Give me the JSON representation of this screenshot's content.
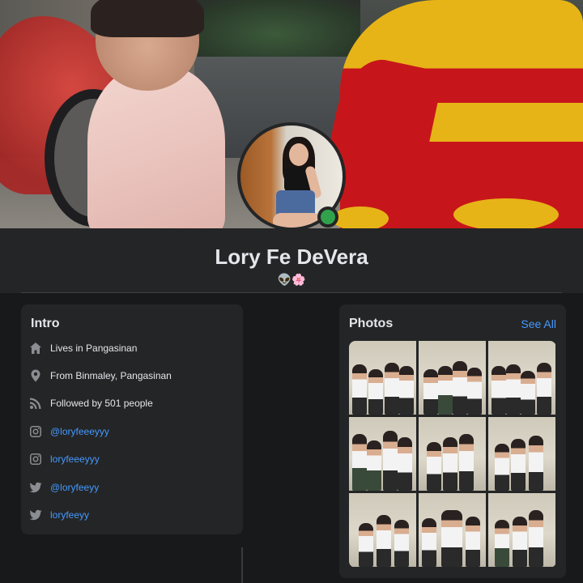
{
  "profile": {
    "name": "Lory Fe DeVera",
    "bio": "👽🌸"
  },
  "intro": {
    "title": "Intro",
    "items": [
      {
        "icon": "home-icon",
        "text": "Lives in Pangasinan"
      },
      {
        "icon": "location-pin-icon",
        "text": "From Binmaley, Pangasinan"
      },
      {
        "icon": "rss-feed-icon",
        "text": "Followed by 501 people"
      },
      {
        "icon": "instagram-icon",
        "text": "@loryfeeeyyy"
      },
      {
        "icon": "instagram-icon",
        "text": "loryfeeeyyy"
      },
      {
        "icon": "twitter-icon",
        "text": "@loryfeeyy"
      },
      {
        "icon": "twitter-icon",
        "text": "loryfeeyy"
      }
    ]
  },
  "photos": {
    "title": "Photos",
    "see_all": "See All",
    "count": 9
  },
  "colors": {
    "page_bg": "#18191a",
    "card_bg": "#242526",
    "link": "#4599ff",
    "online": "#31a24c",
    "text": "#e4e6eb",
    "icon": "#8a8d91"
  }
}
